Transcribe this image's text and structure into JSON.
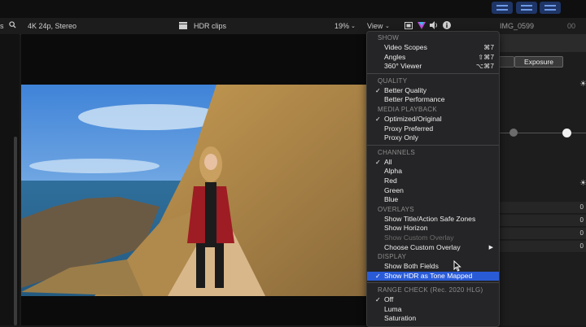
{
  "viewer": {
    "format": "4K 24p, Stereo",
    "clip_name": "HDR clips",
    "zoom": "19%",
    "view_label": "View",
    "clip_id": "IMG_0599"
  },
  "inspector": {
    "tab_active": "Exposure",
    "row_values": [
      "0",
      "0",
      "0",
      "0"
    ]
  },
  "menu": {
    "sections": [
      {
        "title": "SHOW",
        "items": [
          {
            "label": "Video Scopes",
            "shortcut": "⌘7"
          },
          {
            "label": "Angles",
            "shortcut": "⇧⌘7"
          },
          {
            "label": "360° Viewer",
            "shortcut": "⌥⌘7"
          }
        ]
      },
      {
        "title": "QUALITY",
        "items": [
          {
            "label": "Better Quality",
            "checked": true
          },
          {
            "label": "Better Performance"
          }
        ]
      },
      {
        "title": "MEDIA PLAYBACK",
        "items": [
          {
            "label": "Optimized/Original",
            "checked": true
          },
          {
            "label": "Proxy Preferred"
          },
          {
            "label": "Proxy Only"
          }
        ]
      },
      {
        "title": "CHANNELS",
        "items": [
          {
            "label": "All",
            "checked": true
          },
          {
            "label": "Alpha"
          },
          {
            "label": "Red"
          },
          {
            "label": "Green"
          },
          {
            "label": "Blue"
          }
        ]
      },
      {
        "title": "OVERLAYS",
        "items": [
          {
            "label": "Show Title/Action Safe Zones"
          },
          {
            "label": "Show Horizon"
          },
          {
            "label": "Show Custom Overlay",
            "disabled": true
          },
          {
            "label": "Choose Custom Overlay",
            "submenu": true
          }
        ]
      },
      {
        "title": "DISPLAY",
        "items": [
          {
            "label": "Show Both Fields"
          },
          {
            "label": "Show HDR as Tone Mapped",
            "checked": true,
            "highlighted": true
          }
        ]
      },
      {
        "title": "RANGE CHECK (Rec. 2020 HLG)",
        "items": [
          {
            "label": "Off",
            "checked": true
          },
          {
            "label": "Luma"
          },
          {
            "label": "Saturation"
          }
        ]
      }
    ]
  },
  "colors": {
    "highlight": "#2a5bd7",
    "toolbar_button": "#1e3566"
  }
}
